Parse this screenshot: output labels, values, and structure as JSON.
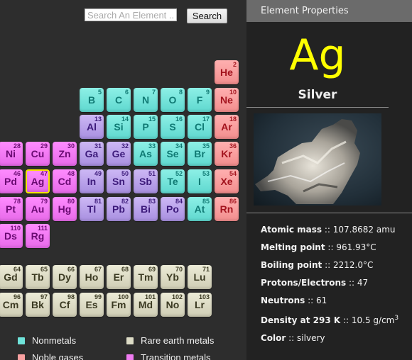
{
  "search": {
    "placeholder": "Search An Element ...",
    "value": "",
    "button_label": "Search"
  },
  "colors": {
    "nonmetal": "#6fe3da",
    "noble_gas": "#f8a0a0",
    "transition_metal": "#f07cf2",
    "post_transition_metal": "#b9a3ea",
    "rare_earth": "#dddcc6",
    "selected_border": "#f5e600",
    "symbol_highlight": "#ffff00"
  },
  "table": {
    "elements": [
      {
        "symbol": "He",
        "number": "2",
        "category": "noble",
        "row": 1,
        "col": 18
      },
      {
        "symbol": "B",
        "number": "5",
        "category": "nonmetal",
        "row": 2,
        "col": 13
      },
      {
        "symbol": "C",
        "number": "6",
        "category": "nonmetal",
        "row": 2,
        "col": 14
      },
      {
        "symbol": "N",
        "number": "7",
        "category": "nonmetal",
        "row": 2,
        "col": 15
      },
      {
        "symbol": "O",
        "number": "8",
        "category": "nonmetal",
        "row": 2,
        "col": 16
      },
      {
        "symbol": "F",
        "number": "9",
        "category": "nonmetal",
        "row": 2,
        "col": 17
      },
      {
        "symbol": "Ne",
        "number": "10",
        "category": "noble",
        "row": 2,
        "col": 18
      },
      {
        "symbol": "Al",
        "number": "13",
        "category": "post",
        "row": 3,
        "col": 13
      },
      {
        "symbol": "Si",
        "number": "14",
        "category": "nonmetal",
        "row": 3,
        "col": 14
      },
      {
        "symbol": "P",
        "number": "15",
        "category": "nonmetal",
        "row": 3,
        "col": 15
      },
      {
        "symbol": "S",
        "number": "16",
        "category": "nonmetal",
        "row": 3,
        "col": 16
      },
      {
        "symbol": "Cl",
        "number": "17",
        "category": "nonmetal",
        "row": 3,
        "col": 17
      },
      {
        "symbol": "Ar",
        "number": "18",
        "category": "noble",
        "row": 3,
        "col": 18
      },
      {
        "symbol": "Ni",
        "number": "28",
        "category": "transition",
        "row": 4,
        "col": 10
      },
      {
        "symbol": "Cu",
        "number": "29",
        "category": "transition",
        "row": 4,
        "col": 11
      },
      {
        "symbol": "Zn",
        "number": "30",
        "category": "transition",
        "row": 4,
        "col": 12
      },
      {
        "symbol": "Ga",
        "number": "31",
        "category": "post",
        "row": 4,
        "col": 13
      },
      {
        "symbol": "Ge",
        "number": "32",
        "category": "post",
        "row": 4,
        "col": 14
      },
      {
        "symbol": "As",
        "number": "33",
        "category": "nonmetal",
        "row": 4,
        "col": 15
      },
      {
        "symbol": "Se",
        "number": "34",
        "category": "nonmetal",
        "row": 4,
        "col": 16
      },
      {
        "symbol": "Br",
        "number": "35",
        "category": "nonmetal",
        "row": 4,
        "col": 17
      },
      {
        "symbol": "Kr",
        "number": "36",
        "category": "noble",
        "row": 4,
        "col": 18
      },
      {
        "symbol": "Pd",
        "number": "46",
        "category": "transition",
        "row": 5,
        "col": 10
      },
      {
        "symbol": "Ag",
        "number": "47",
        "category": "transition",
        "row": 5,
        "col": 11,
        "selected": true
      },
      {
        "symbol": "Cd",
        "number": "48",
        "category": "transition",
        "row": 5,
        "col": 12
      },
      {
        "symbol": "In",
        "number": "49",
        "category": "post",
        "row": 5,
        "col": 13
      },
      {
        "symbol": "Sn",
        "number": "50",
        "category": "post",
        "row": 5,
        "col": 14
      },
      {
        "symbol": "Sb",
        "number": "51",
        "category": "post",
        "row": 5,
        "col": 15
      },
      {
        "symbol": "Te",
        "number": "52",
        "category": "nonmetal",
        "row": 5,
        "col": 16
      },
      {
        "symbol": "I",
        "number": "53",
        "category": "nonmetal",
        "row": 5,
        "col": 17
      },
      {
        "symbol": "Xe",
        "number": "54",
        "category": "noble",
        "row": 5,
        "col": 18
      },
      {
        "symbol": "Pt",
        "number": "78",
        "category": "transition",
        "row": 6,
        "col": 10
      },
      {
        "symbol": "Au",
        "number": "79",
        "category": "transition",
        "row": 6,
        "col": 11
      },
      {
        "symbol": "Hg",
        "number": "80",
        "category": "transition",
        "row": 6,
        "col": 12
      },
      {
        "symbol": "Tl",
        "number": "81",
        "category": "post",
        "row": 6,
        "col": 13
      },
      {
        "symbol": "Pb",
        "number": "82",
        "category": "post",
        "row": 6,
        "col": 14
      },
      {
        "symbol": "Bi",
        "number": "83",
        "category": "post",
        "row": 6,
        "col": 15
      },
      {
        "symbol": "Po",
        "number": "84",
        "category": "post",
        "row": 6,
        "col": 16
      },
      {
        "symbol": "At",
        "number": "85",
        "category": "nonmetal",
        "row": 6,
        "col": 17
      },
      {
        "symbol": "Rn",
        "number": "86",
        "category": "noble",
        "row": 6,
        "col": 18
      },
      {
        "symbol": "Ds",
        "number": "110",
        "category": "transition",
        "row": 7,
        "col": 10
      },
      {
        "symbol": "Rg",
        "number": "111",
        "category": "transition",
        "row": 7,
        "col": 11
      }
    ],
    "rare_earths": [
      {
        "symbol": "Gd",
        "number": "64",
        "row": 1,
        "col": 1
      },
      {
        "symbol": "Tb",
        "number": "65",
        "row": 1,
        "col": 2
      },
      {
        "symbol": "Dy",
        "number": "66",
        "row": 1,
        "col": 3
      },
      {
        "symbol": "Ho",
        "number": "67",
        "row": 1,
        "col": 4
      },
      {
        "symbol": "Er",
        "number": "68",
        "row": 1,
        "col": 5
      },
      {
        "symbol": "Tm",
        "number": "69",
        "row": 1,
        "col": 6
      },
      {
        "symbol": "Yb",
        "number": "70",
        "row": 1,
        "col": 7
      },
      {
        "symbol": "Lu",
        "number": "71",
        "row": 1,
        "col": 8
      },
      {
        "symbol": "Cm",
        "number": "96",
        "row": 2,
        "col": 1
      },
      {
        "symbol": "Bk",
        "number": "97",
        "row": 2,
        "col": 2
      },
      {
        "symbol": "Cf",
        "number": "98",
        "row": 2,
        "col": 3
      },
      {
        "symbol": "Es",
        "number": "99",
        "row": 2,
        "col": 4
      },
      {
        "symbol": "Fm",
        "number": "100",
        "row": 2,
        "col": 5
      },
      {
        "symbol": "Md",
        "number": "101",
        "row": 2,
        "col": 6
      },
      {
        "symbol": "No",
        "number": "102",
        "row": 2,
        "col": 7
      },
      {
        "symbol": "Lr",
        "number": "103",
        "row": 2,
        "col": 8
      }
    ]
  },
  "legend": [
    {
      "label": "Nonmetals",
      "category": "nonmetal"
    },
    {
      "label": "Rare earth metals",
      "category": "rare"
    },
    {
      "label": "Noble gases",
      "category": "noble"
    },
    {
      "label": "Transition metals",
      "category": "transition"
    }
  ],
  "panel": {
    "title": "Element Properties",
    "symbol": "Ag",
    "name": "Silver",
    "image_alt": "silver crystal photo",
    "properties": [
      {
        "key": "Atomic mass",
        "sep": " :: ",
        "value": "107.8682 amu"
      },
      {
        "key": "Melting point",
        "sep": " :: ",
        "value": "961.93°C"
      },
      {
        "key": "Boiling point",
        "sep": " :: ",
        "value": "2212.0°C"
      },
      {
        "key": "Protons/Electrons",
        "sep": " :: ",
        "value": "47"
      },
      {
        "key": "Neutrons",
        "sep": " :: ",
        "value": "61"
      },
      {
        "key": "Density at 293 K",
        "sep": " :: ",
        "value": "10.5 g/cm",
        "sup": "3"
      },
      {
        "key": "Color",
        "sep": " :: ",
        "value": "silvery"
      }
    ]
  }
}
